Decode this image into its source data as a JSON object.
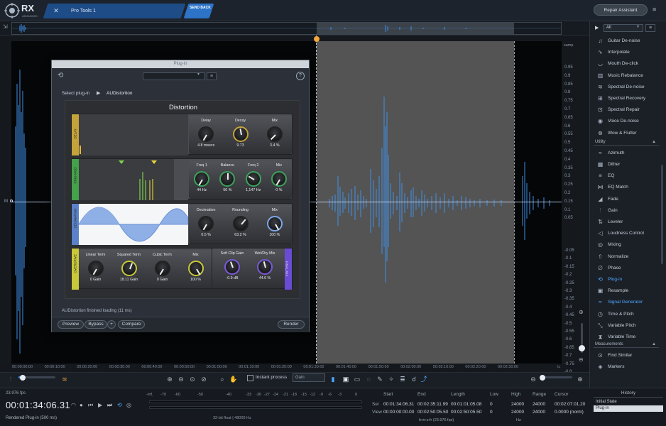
{
  "app": {
    "logo_text": "RX",
    "logo_sub": "ADVANCED",
    "doc_tab": "Pro Tools 1",
    "send_back": "SEND BACK",
    "repair_assistant": "Repair Assistant"
  },
  "waveform": {
    "y_unit": "samp",
    "y_ticks": [
      "0.95",
      "0.9",
      "0.85",
      "0.8",
      "0.75",
      "0.7",
      "0.65",
      "0.6",
      "0.55",
      "0.5",
      "0.45",
      "0.4",
      "0.35",
      "0.3",
      "0.25",
      "0.2",
      "0.15",
      "0.1",
      "0.05",
      "-0.05",
      "-0.1",
      "-0.15",
      "-0.2",
      "-0.25",
      "-0.3",
      "-0.35",
      "-0.4",
      "-0.45",
      "-0.5",
      "-0.55",
      "-0.6",
      "-0.65",
      "-0.7",
      "-0.75",
      "-0.8",
      "-0.85",
      "-0.9",
      "-0.95"
    ],
    "x_ticks": [
      "00:00:00:00",
      "00:00:10:00",
      "00:00:20:00",
      "00:00:30:00",
      "00:00:40:00",
      "00:00:50:00",
      "00:01:00:00",
      "00:01:10:00",
      "00:01:20:00",
      "00:01:30:00",
      "00:01:40:00",
      "00:01:50:00",
      "00:02:00:00",
      "00:02:10:00",
      "00:02:20:00",
      "00:02:30:00"
    ],
    "x_unit": "tc",
    "channel_label": "M"
  },
  "plugin": {
    "window_title": "Plug-in",
    "select_label": "Select plug-in",
    "plugin_name": "AUDistortion",
    "au_title": "Distortion",
    "status": "AUDistortion finished loading (11 ms)",
    "buttons": {
      "preview": "Preview",
      "bypass": "Bypass",
      "plus": "+",
      "compare": "Compare",
      "render": "Render"
    },
    "modules": [
      {
        "name": "DELAY",
        "color": "#c4a43a",
        "knobs": [
          {
            "label": "Delay",
            "value": "4.8 msecs",
            "angle": -150
          },
          {
            "label": "Decay",
            "value": "9.73",
            "angle": -10
          },
          {
            "label": "Mix",
            "value": "3.4 %",
            "angle": -135
          }
        ]
      },
      {
        "name": "RING MOD",
        "color": "#44a24a",
        "knobs": [
          {
            "label": "Freq 1",
            "value": "44 Hz",
            "angle": -150
          },
          {
            "label": "Balance",
            "value": "50 %",
            "angle": 0
          },
          {
            "label": "Freq 2",
            "value": "1,147 Hz",
            "angle": -60
          },
          {
            "label": "Mix",
            "value": "0 %",
            "angle": -150
          }
        ]
      },
      {
        "name": "DECIMATION",
        "color": "#5b82c8",
        "knobs": [
          {
            "label": "Decimation",
            "value": "0.5 %",
            "angle": -150
          },
          {
            "label": "Rounding",
            "value": "63.2 %",
            "angle": 40
          },
          {
            "label": "Mix",
            "value": "100 %",
            "angle": 150
          }
        ]
      },
      {
        "name": "OVERDRIVE",
        "color": "#c8c83a",
        "knobs": [
          {
            "label": "Linear Term",
            "value": "0 Gain",
            "angle": -150
          },
          {
            "label": "Squared Term",
            "value": "18.11 Gain",
            "angle": 20
          },
          {
            "label": "Cubic Term",
            "value": "0 Gain",
            "angle": -150
          },
          {
            "label": "Mix",
            "value": "100 %",
            "angle": 150
          }
        ]
      },
      {
        "name": "FINAL MIX",
        "color": "#6a4bd4",
        "knobs": [
          {
            "label": "Soft Clip Gain",
            "value": "-0.9 dB",
            "angle": -20
          },
          {
            "label": "Wet/Dry Mix",
            "value": "44.6 %",
            "angle": -15
          }
        ]
      }
    ]
  },
  "module_panel": {
    "filter": "All",
    "items_top": [
      {
        "label": "Guitar De-noise",
        "icon": "guitar-icon",
        "glyph": "♫"
      },
      {
        "label": "Interpolate",
        "icon": "interpolate-icon",
        "glyph": "∿"
      },
      {
        "label": "Mouth De-click",
        "icon": "mouth-icon",
        "glyph": "◡"
      },
      {
        "label": "Music Rebalance",
        "icon": "rebalance-icon",
        "glyph": "▥"
      },
      {
        "label": "Spectral De-noise",
        "icon": "spectral-denoise-icon",
        "glyph": "≋"
      },
      {
        "label": "Spectral Recovery",
        "icon": "spectral-recovery-icon",
        "glyph": "⊞"
      },
      {
        "label": "Spectral Repair",
        "icon": "spectral-repair-icon",
        "glyph": "⊡"
      },
      {
        "label": "Voice De-noise",
        "icon": "voice-icon",
        "glyph": "◉"
      },
      {
        "label": "Wow & Flutter",
        "icon": "wow-icon",
        "glyph": "⊗"
      }
    ],
    "utility_label": "Utility",
    "items_utility": [
      {
        "label": "Azimuth",
        "icon": "azimuth-icon",
        "glyph": "≈"
      },
      {
        "label": "Dither",
        "icon": "dither-icon",
        "glyph": "▦"
      },
      {
        "label": "EQ",
        "icon": "eq-icon",
        "glyph": "≡"
      },
      {
        "label": "EQ Match",
        "icon": "eq-match-icon",
        "glyph": "⋈"
      },
      {
        "label": "Fade",
        "icon": "fade-icon",
        "glyph": "◢"
      },
      {
        "label": "Gain",
        "icon": "gain-icon",
        "glyph": "⫶"
      },
      {
        "label": "Leveler",
        "icon": "leveler-icon",
        "glyph": "⇅"
      },
      {
        "label": "Loudness Control",
        "icon": "loudness-icon",
        "glyph": "◁"
      },
      {
        "label": "Mixing",
        "icon": "mixing-icon",
        "glyph": "◎"
      },
      {
        "label": "Normalize",
        "icon": "normalize-icon",
        "glyph": "⇧"
      },
      {
        "label": "Phase",
        "icon": "phase-icon",
        "glyph": "∅"
      },
      {
        "label": "Plug-in",
        "icon": "plugin-icon",
        "glyph": "⟲",
        "active": true
      },
      {
        "label": "Resample",
        "icon": "resample-icon",
        "glyph": "▣"
      },
      {
        "label": "Signal Generator",
        "icon": "signal-gen-icon",
        "glyph": "≈",
        "active": true
      },
      {
        "label": "Time & Pitch",
        "icon": "time-pitch-icon",
        "glyph": "◷"
      },
      {
        "label": "Variable Pitch",
        "icon": "var-pitch-icon",
        "glyph": "⤡"
      },
      {
        "label": "Variable Time",
        "icon": "var-time-icon",
        "glyph": "⧗"
      }
    ],
    "measurements_label": "Measurements",
    "items_measure": [
      {
        "label": "Find Similar",
        "icon": "find-similar-icon",
        "glyph": "⊙"
      },
      {
        "label": "Markers",
        "icon": "markers-icon",
        "glyph": "◈"
      }
    ]
  },
  "toolbar": {
    "instant_process": "Instant process",
    "gain_select": "Gain"
  },
  "footer": {
    "fps": "23.976 fps",
    "timecode": "00:01:34:06.31",
    "rendered": "Rendered Plug-in (500 ms)",
    "meter_ticks": [
      "-Inf.",
      "-70",
      "-60",
      "-50",
      "-40",
      "-33",
      "-30",
      "-27",
      "-24",
      "-21",
      "-18",
      "-15",
      "-12",
      "-9",
      "-6",
      "-3",
      "0"
    ],
    "bit_depth": "32-bit float | 48000 Hz",
    "sel_headers": {
      "start": "Start",
      "end": "End",
      "length": "Length",
      "low": "Low",
      "high": "High",
      "range": "Range",
      "cursor": "Cursor"
    },
    "sel_row": {
      "label": "Sel",
      "start": "00:01:34:06.31",
      "end": "00:02:35:11.99",
      "length": "00:01:01:05.08",
      "low": "0",
      "high": "24000",
      "range": "24000",
      "cursor": "00:02:07:01.20"
    },
    "view_row": {
      "label": "View",
      "start": "00:00:00:00.00",
      "end": "00:02:50:05.50",
      "length": "00:02:50:05.50",
      "low": "0",
      "high": "24000",
      "range": "24000",
      "cursor": "0.0000 (norm)"
    },
    "tc_unit": "h:m:s:fr (23.976 fps)",
    "hz_unit": "Hz",
    "history_title": "History",
    "history_items": [
      "Initial State",
      "Plug-in"
    ]
  }
}
